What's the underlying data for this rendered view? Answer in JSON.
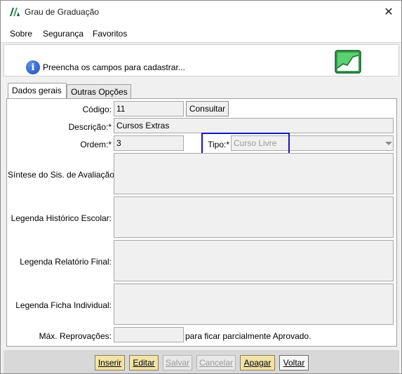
{
  "window": {
    "title": "Grau de Graduação"
  },
  "menu": [
    {
      "label": "Sobre"
    },
    {
      "label": "Segurança"
    },
    {
      "label": "Favoritos"
    }
  ],
  "banner": {
    "message": "Preencha os campos para cadastrar..."
  },
  "tabs": [
    {
      "label": "Dados gerais",
      "active": true
    },
    {
      "label": "Outras Opções",
      "active": false
    }
  ],
  "form": {
    "codigo": {
      "label": "Código:",
      "value": "11",
      "button": "Consultar"
    },
    "descricao": {
      "label": "Descrição:*",
      "value": "Cursos Extras"
    },
    "ordem": {
      "label": "Ordem:*",
      "value": "3"
    },
    "tipo": {
      "label": "Tipo:*",
      "value": "Curso Livre"
    },
    "sintese": {
      "label": "Síntese do Sis. de Avaliação:"
    },
    "legenda_historico": {
      "label": "Legenda Histórico Escolar:"
    },
    "legenda_relatorio": {
      "label": "Legenda Relatório Final:"
    },
    "legenda_ficha": {
      "label": "Legenda Ficha Individual:"
    },
    "max_reprovacoes": {
      "label": "Máx. Reprovações:",
      "value": "",
      "suffix": "para ficar parcialmente Aprovado."
    }
  },
  "actions": {
    "inserir": "Inserir",
    "editar": "Editar",
    "salvar": "Salvar",
    "cancelar": "Cancelar",
    "apagar": "Apagar",
    "voltar": "Voltar"
  },
  "colors": {
    "accent_button": "#f1e4a8",
    "highlight_border": "#1515c8"
  }
}
